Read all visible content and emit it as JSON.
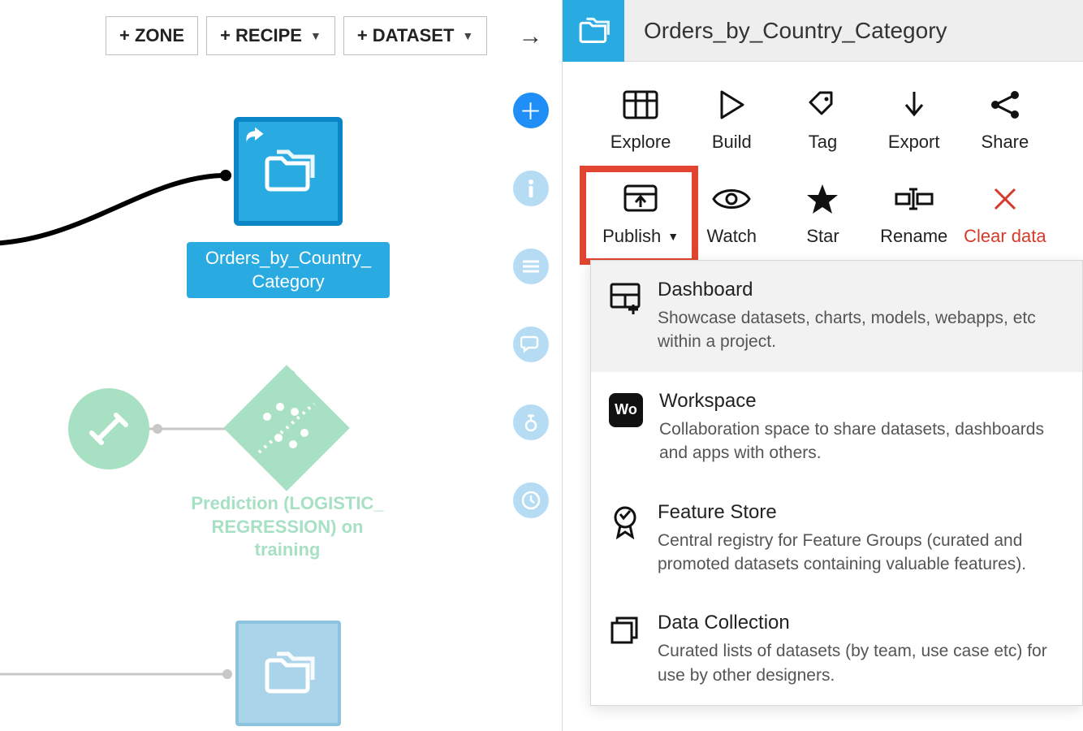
{
  "toolbar": {
    "zone": "+ ZONE",
    "recipe": "+ RECIPE",
    "dataset": "+ DATASET"
  },
  "flow": {
    "selected_node_label": "Orders_by_Country_ Category",
    "prediction_label": "Prediction (LOGISTIC_ REGRESSION) on training"
  },
  "panel": {
    "title": "Orders_by_Country_Category",
    "actions": {
      "explore": "Explore",
      "build": "Build",
      "tag": "Tag",
      "export": "Export",
      "share": "Share",
      "publish": "Publish",
      "watch": "Watch",
      "star": "Star",
      "rename": "Rename",
      "clear_data": "Clear data"
    }
  },
  "publish_menu": [
    {
      "title": "Dashboard",
      "desc": "Showcase datasets, charts, models, webapps, etc within a project."
    },
    {
      "title": "Workspace",
      "desc": "Collaboration space to share datasets, dashboards and apps with others."
    },
    {
      "title": "Feature Store",
      "desc": "Central registry for Feature Groups (curated and promoted datasets containing valuable features)."
    },
    {
      "title": "Data Collection",
      "desc": "Curated lists of datasets (by team, use case etc) for use by other designers."
    }
  ]
}
